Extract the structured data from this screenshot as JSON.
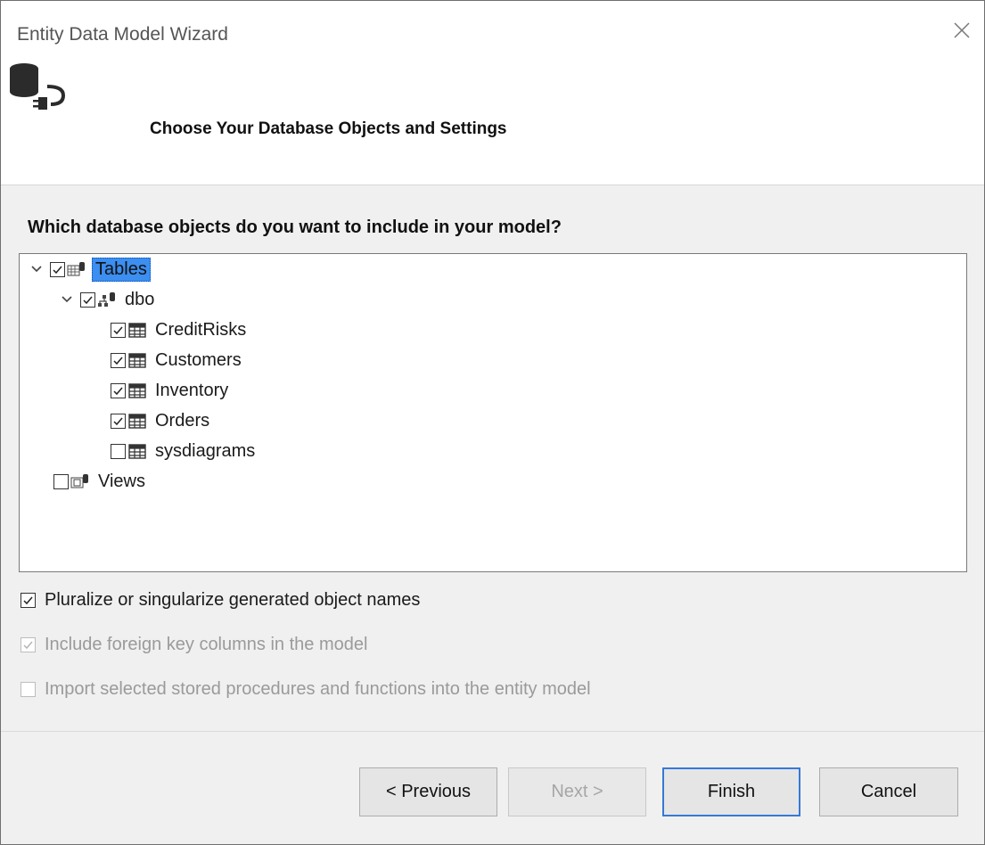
{
  "window": {
    "title": "Entity Data Model Wizard"
  },
  "header": {
    "subtitle": "Choose Your Database Objects and Settings",
    "icon": "database-connection-icon"
  },
  "question": "Which database objects do you want to include in your model?",
  "tree": {
    "tables": {
      "label": "Tables",
      "checked": true,
      "expanded": true,
      "selected": true
    },
    "dbo": {
      "label": "dbo",
      "checked": true,
      "expanded": true
    },
    "items": [
      {
        "label": "CreditRisks",
        "checked": true
      },
      {
        "label": "Customers",
        "checked": true
      },
      {
        "label": "Inventory",
        "checked": true
      },
      {
        "label": "Orders",
        "checked": true
      },
      {
        "label": "sysdiagrams",
        "checked": false
      }
    ],
    "views": {
      "label": "Views",
      "checked": false
    }
  },
  "options": {
    "pluralize": {
      "label": "Pluralize or singularize generated object names",
      "checked": true,
      "enabled": true
    },
    "foreign_keys": {
      "label": "Include foreign key columns in the model",
      "checked": true,
      "enabled": false
    },
    "import_procs": {
      "label": "Import selected stored procedures and functions into the entity model",
      "checked": false,
      "enabled": false
    }
  },
  "buttons": {
    "previous": "< Previous",
    "next": "Next >",
    "finish": "Finish",
    "cancel": "Cancel"
  }
}
